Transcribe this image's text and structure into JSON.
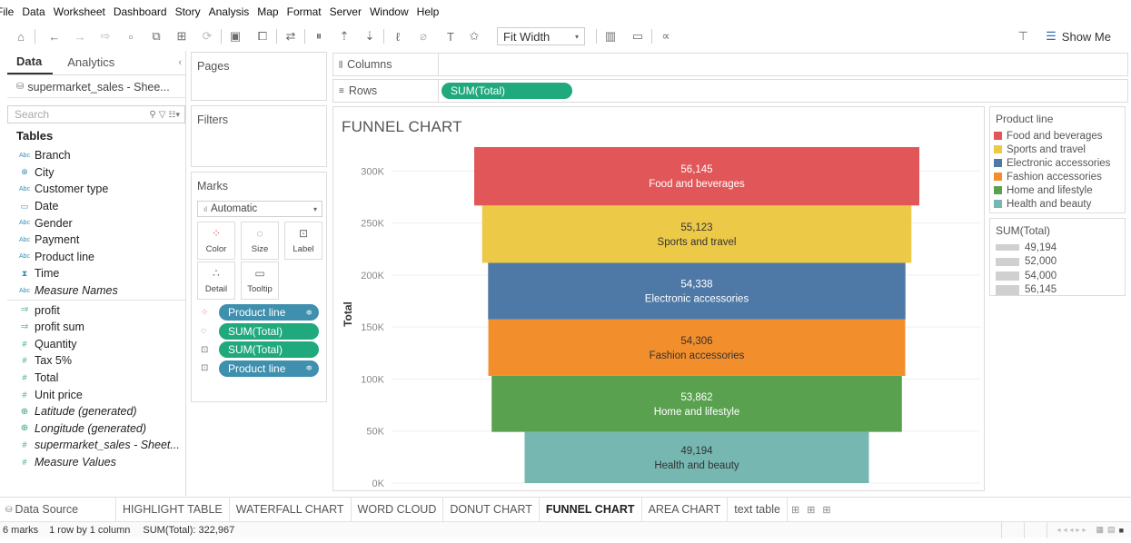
{
  "menu": [
    "File",
    "Data",
    "Worksheet",
    "Dashboard",
    "Story",
    "Analysis",
    "Map",
    "Format",
    "Server",
    "Window",
    "Help"
  ],
  "toolbar": {
    "fit": "Fit Width",
    "show_me": "Show Me"
  },
  "left_panel": {
    "tab_data": "Data",
    "tab_analytics": "Analytics",
    "datasource": "supermarket_sales - Shee...",
    "search_placeholder": "Search",
    "tables_heading": "Tables",
    "fields": [
      {
        "label": "Branch",
        "icon": "Abc",
        "type": "dim"
      },
      {
        "label": "City",
        "icon": "globe",
        "type": "dim"
      },
      {
        "label": "Customer type",
        "icon": "Abc",
        "type": "dim"
      },
      {
        "label": "Date",
        "icon": "calendar",
        "type": "dim"
      },
      {
        "label": "Gender",
        "icon": "Abc",
        "type": "dim"
      },
      {
        "label": "Payment",
        "icon": "Abc",
        "type": "dim"
      },
      {
        "label": "Product line",
        "icon": "Abc",
        "type": "dim"
      },
      {
        "label": "Time",
        "icon": "datetime",
        "type": "dim"
      },
      {
        "label": "Measure Names",
        "icon": "Abc",
        "type": "dim",
        "italic": true
      },
      {
        "label": "profit",
        "icon": "=#",
        "type": "measure"
      },
      {
        "label": "profit sum",
        "icon": "=#",
        "type": "measure"
      },
      {
        "label": "Quantity",
        "icon": "#",
        "type": "measure"
      },
      {
        "label": "Tax 5%",
        "icon": "#",
        "type": "measure"
      },
      {
        "label": "Total",
        "icon": "#",
        "type": "measure"
      },
      {
        "label": "Unit price",
        "icon": "#",
        "type": "measure"
      },
      {
        "label": "Latitude (generated)",
        "icon": "globe",
        "type": "measure",
        "italic": true
      },
      {
        "label": "Longitude (generated)",
        "icon": "globe",
        "type": "measure",
        "italic": true
      },
      {
        "label": "supermarket_sales - Sheet...",
        "icon": "#",
        "type": "measure",
        "italic": true
      },
      {
        "label": "Measure Values",
        "icon": "#",
        "type": "measure",
        "italic": true
      }
    ]
  },
  "shelves": {
    "pages": "Pages",
    "filters": "Filters",
    "marks": "Marks",
    "mark_type": "Automatic",
    "columns": "Columns",
    "rows": "Rows",
    "rows_pill": "SUM(Total)",
    "mark_buttons": [
      "Color",
      "Size",
      "Label",
      "Detail",
      "Tooltip"
    ],
    "mark_pills": [
      "Product line",
      "SUM(Total)",
      "SUM(Total)",
      "Product line"
    ]
  },
  "chart_data": {
    "type": "bar",
    "title": "FUNNEL CHART",
    "ylabel": "Total",
    "xlabel": "",
    "ylim": [
      0,
      322967
    ],
    "yticks": [
      "0K",
      "50K",
      "100K",
      "150K",
      "200K",
      "250K",
      "300K"
    ],
    "ytick_values": [
      0,
      50000,
      100000,
      150000,
      200000,
      250000,
      300000
    ],
    "categories": [
      "Food and beverages",
      "Sports and travel",
      "Electronic accessories",
      "Fashion accessories",
      "Home and lifestyle",
      "Health and beauty"
    ],
    "values": [
      56145,
      55123,
      54338,
      54306,
      53862,
      49194
    ],
    "labels": [
      "56,145",
      "55,123",
      "54,338",
      "54,306",
      "53,862",
      "49,194"
    ],
    "colors": [
      "#e15759",
      "#edc948",
      "#4e79a7",
      "#f28e2b",
      "#59a14f",
      "#76b7b2"
    ],
    "label_colors": [
      "#ffffff",
      "#333333",
      "#ffffff",
      "#333333",
      "#ffffff",
      "#333333"
    ],
    "stacked": true,
    "legend_position": "right"
  },
  "legend": {
    "title": "Product line",
    "items": [
      {
        "label": "Food and beverages",
        "color": "#e15759"
      },
      {
        "label": "Sports and travel",
        "color": "#edc948"
      },
      {
        "label": "Electronic accessories",
        "color": "#4e79a7"
      },
      {
        "label": "Fashion accessories",
        "color": "#f28e2b"
      },
      {
        "label": "Home and lifestyle",
        "color": "#59a14f"
      },
      {
        "label": "Health and beauty",
        "color": "#76b7b2"
      }
    ],
    "size_title": "SUM(Total)",
    "size_items": [
      "49,194",
      "52,000",
      "54,000",
      "56,145"
    ]
  },
  "sheet_tabs": [
    "Data Source",
    "HIGHLIGHT TABLE",
    "WATERFALL CHART",
    "WORD CLOUD",
    "DONUT CHART",
    "FUNNEL CHART",
    "AREA CHART",
    "text table"
  ],
  "active_tab": "FUNNEL CHART",
  "status": {
    "marks": "6 marks",
    "rows_cols": "1 row by 1 column",
    "sum": "SUM(Total): 322,967"
  }
}
